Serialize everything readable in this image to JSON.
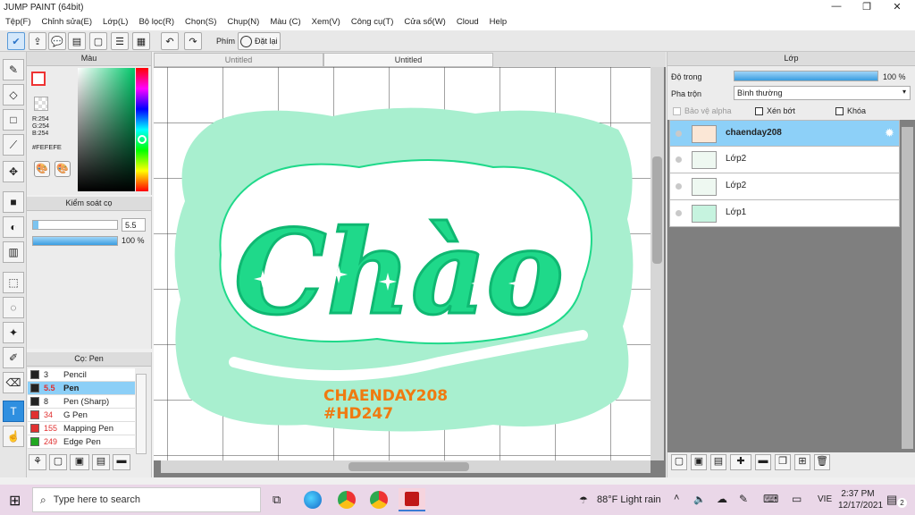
{
  "app": {
    "title": "JUMP PAINT (64bit)"
  },
  "menu": [
    "Tệp(F)",
    "Chỉnh sửa(E)",
    "Lớp(L)",
    "Bộ lọc(R)",
    "Chọn(S)",
    "Chụp(N)",
    "Màu (C)",
    "Xem(V)",
    "Công cụ(T)",
    "Cửa sổ(W)",
    "Cloud",
    "Help"
  ],
  "toolbar": {
    "key_label": "Phím",
    "reset_label": "Đặt lại"
  },
  "color_panel": {
    "title": "Màu",
    "r": "R:254",
    "g": "G:254",
    "b": "B:254",
    "hex": "#FEFEFE",
    "accent": "#f0640a"
  },
  "brush_control": {
    "title": "Kiểm soát cọ",
    "size": "5.5",
    "opacity": "100 %"
  },
  "pen_panel": {
    "title": "Cọ: Pen",
    "items": [
      {
        "size": "3",
        "name": "Pencil",
        "color": "#222222"
      },
      {
        "size": "5.5",
        "name": "Pen",
        "color": "#222222"
      },
      {
        "size": "8",
        "name": "Pen (Sharp)",
        "color": "#222222"
      },
      {
        "size": "34",
        "name": "G Pen",
        "color": "#e03030"
      },
      {
        "size": "155",
        "name": "Mapping Pen",
        "color": "#e03030"
      },
      {
        "size": "249",
        "name": "Edge Pen",
        "color": "#22a822"
      }
    ]
  },
  "tabs": [
    "Untitled",
    "Untitled"
  ],
  "artwork": {
    "word": "Chào",
    "credit1": "CHAENDAY208",
    "credit2": "#HD247",
    "mint": "#a8efcf",
    "green": "#1fd98a",
    "orange": "#f07a10"
  },
  "layer_panel": {
    "title": "Lớp",
    "opacity_label": "Độ trong",
    "opacity_value": "100 %",
    "blend_label": "Pha trộn",
    "blend_value": "Bình thường",
    "protect_alpha": "Bảo vệ alpha",
    "clip": "Xén bớt",
    "lock": "Khóa",
    "layers": [
      "chaenday208",
      "Lớp2",
      "Lớp2",
      "Lớp1"
    ]
  },
  "taskbar": {
    "search_placeholder": "Type here to search",
    "weather": "88°F  Light rain",
    "lang": "VIE",
    "time": "2:37 PM",
    "date": "12/17/2021",
    "notif_count": "2"
  }
}
